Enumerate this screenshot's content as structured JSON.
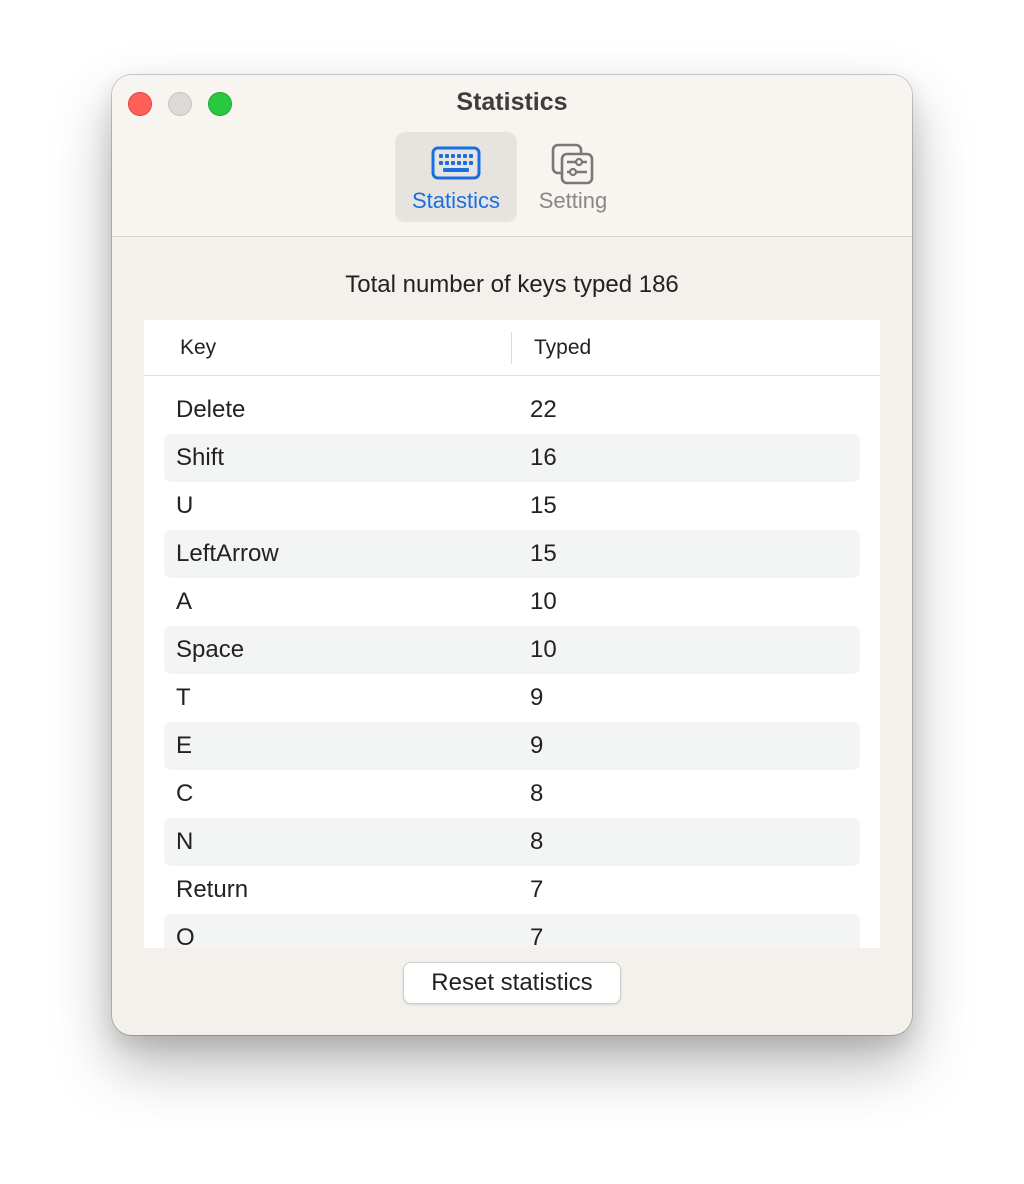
{
  "window": {
    "title": "Statistics"
  },
  "toolbar": {
    "tabs": [
      {
        "label": "Statistics",
        "icon": "keyboard-icon",
        "selected": true
      },
      {
        "label": "Setting",
        "icon": "settings-sliders-icon",
        "selected": false
      }
    ]
  },
  "summary": {
    "text": "Total number of keys typed 186"
  },
  "table": {
    "columns": [
      "Key",
      "Typed"
    ],
    "rows": [
      {
        "key": "Delete",
        "typed": "22"
      },
      {
        "key": "Shift",
        "typed": "16"
      },
      {
        "key": "U",
        "typed": "15"
      },
      {
        "key": "LeftArrow",
        "typed": "15"
      },
      {
        "key": "A",
        "typed": "10"
      },
      {
        "key": "Space",
        "typed": "10"
      },
      {
        "key": "T",
        "typed": "9"
      },
      {
        "key": "E",
        "typed": "9"
      },
      {
        "key": "C",
        "typed": "8"
      },
      {
        "key": "N",
        "typed": "8"
      },
      {
        "key": "Return",
        "typed": "7"
      },
      {
        "key": "O",
        "typed": "7"
      }
    ]
  },
  "footer": {
    "reset_label": "Reset statistics"
  },
  "colors": {
    "accent": "#1a6fe0",
    "close": "#ff5f57",
    "minimize": "#dcdad6",
    "zoom": "#28c840"
  }
}
